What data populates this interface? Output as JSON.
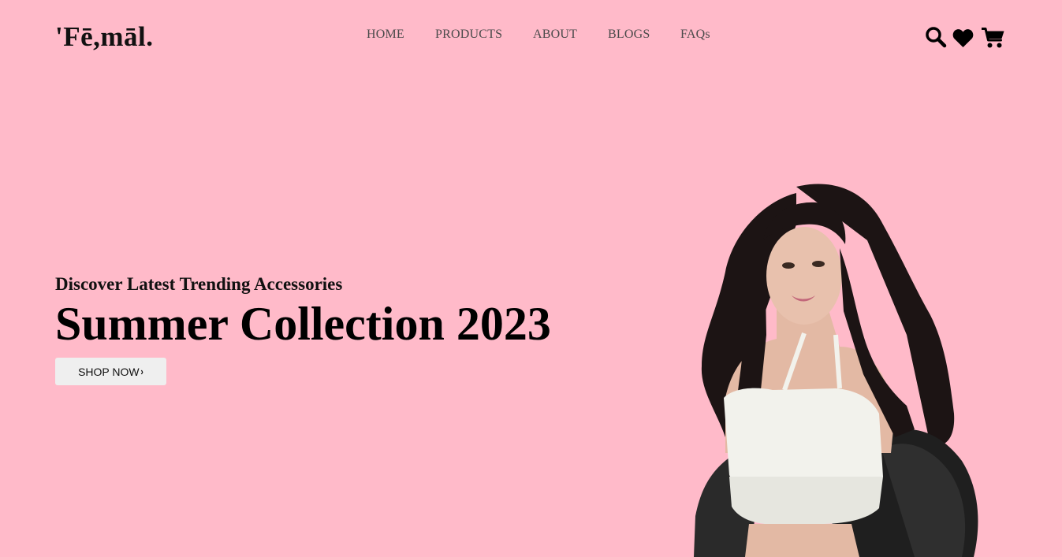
{
  "brand": {
    "logo": "'Fē,māl."
  },
  "nav": {
    "items": [
      {
        "label": "HOME"
      },
      {
        "label": "PRODUCTS"
      },
      {
        "label": "ABOUT"
      },
      {
        "label": "BLOGS"
      },
      {
        "label": "FAQs"
      }
    ]
  },
  "header_icons": [
    "search-icon",
    "heart-icon",
    "cart-icon"
  ],
  "hero": {
    "subtitle": "Discover Latest Trending Accessories",
    "title": "Summer Collection 2023",
    "button_label": "SHOP NOW",
    "button_chevron": "›"
  },
  "colors": {
    "background": "#ffbac9",
    "button_bg": "#efefef",
    "text": "#000000"
  }
}
